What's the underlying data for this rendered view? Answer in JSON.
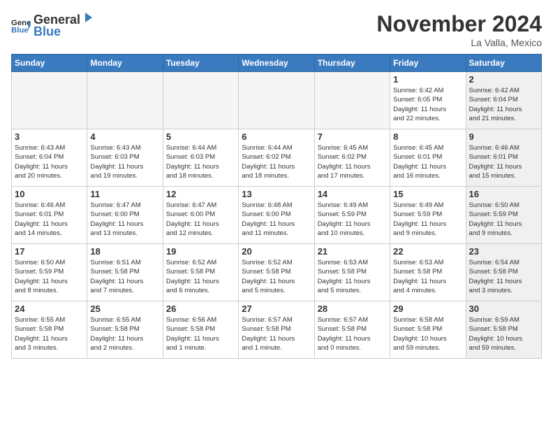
{
  "header": {
    "logo_general": "General",
    "logo_blue": "Blue",
    "month_title": "November 2024",
    "location": "La Valla, Mexico"
  },
  "weekdays": [
    "Sunday",
    "Monday",
    "Tuesday",
    "Wednesday",
    "Thursday",
    "Friday",
    "Saturday"
  ],
  "weeks": [
    [
      {
        "day": "",
        "info": "",
        "empty": true
      },
      {
        "day": "",
        "info": "",
        "empty": true
      },
      {
        "day": "",
        "info": "",
        "empty": true
      },
      {
        "day": "",
        "info": "",
        "empty": true
      },
      {
        "day": "",
        "info": "",
        "empty": true
      },
      {
        "day": "1",
        "info": "Sunrise: 6:42 AM\nSunset: 6:05 PM\nDaylight: 11 hours\nand 22 minutes.",
        "shaded": false
      },
      {
        "day": "2",
        "info": "Sunrise: 6:42 AM\nSunset: 6:04 PM\nDaylight: 11 hours\nand 21 minutes.",
        "shaded": true
      }
    ],
    [
      {
        "day": "3",
        "info": "Sunrise: 6:43 AM\nSunset: 6:04 PM\nDaylight: 11 hours\nand 20 minutes.",
        "shaded": false
      },
      {
        "day": "4",
        "info": "Sunrise: 6:43 AM\nSunset: 6:03 PM\nDaylight: 11 hours\nand 19 minutes.",
        "shaded": false
      },
      {
        "day": "5",
        "info": "Sunrise: 6:44 AM\nSunset: 6:03 PM\nDaylight: 11 hours\nand 18 minutes.",
        "shaded": false
      },
      {
        "day": "6",
        "info": "Sunrise: 6:44 AM\nSunset: 6:02 PM\nDaylight: 11 hours\nand 18 minutes.",
        "shaded": false
      },
      {
        "day": "7",
        "info": "Sunrise: 6:45 AM\nSunset: 6:02 PM\nDaylight: 11 hours\nand 17 minutes.",
        "shaded": false
      },
      {
        "day": "8",
        "info": "Sunrise: 6:45 AM\nSunset: 6:01 PM\nDaylight: 11 hours\nand 16 minutes.",
        "shaded": false
      },
      {
        "day": "9",
        "info": "Sunrise: 6:46 AM\nSunset: 6:01 PM\nDaylight: 11 hours\nand 15 minutes.",
        "shaded": true
      }
    ],
    [
      {
        "day": "10",
        "info": "Sunrise: 6:46 AM\nSunset: 6:01 PM\nDaylight: 11 hours\nand 14 minutes.",
        "shaded": false
      },
      {
        "day": "11",
        "info": "Sunrise: 6:47 AM\nSunset: 6:00 PM\nDaylight: 11 hours\nand 13 minutes.",
        "shaded": false
      },
      {
        "day": "12",
        "info": "Sunrise: 6:47 AM\nSunset: 6:00 PM\nDaylight: 11 hours\nand 12 minutes.",
        "shaded": false
      },
      {
        "day": "13",
        "info": "Sunrise: 6:48 AM\nSunset: 6:00 PM\nDaylight: 11 hours\nand 11 minutes.",
        "shaded": false
      },
      {
        "day": "14",
        "info": "Sunrise: 6:49 AM\nSunset: 5:59 PM\nDaylight: 11 hours\nand 10 minutes.",
        "shaded": false
      },
      {
        "day": "15",
        "info": "Sunrise: 6:49 AM\nSunset: 5:59 PM\nDaylight: 11 hours\nand 9 minutes.",
        "shaded": false
      },
      {
        "day": "16",
        "info": "Sunrise: 6:50 AM\nSunset: 5:59 PM\nDaylight: 11 hours\nand 9 minutes.",
        "shaded": true
      }
    ],
    [
      {
        "day": "17",
        "info": "Sunrise: 6:50 AM\nSunset: 5:59 PM\nDaylight: 11 hours\nand 8 minutes.",
        "shaded": false
      },
      {
        "day": "18",
        "info": "Sunrise: 6:51 AM\nSunset: 5:58 PM\nDaylight: 11 hours\nand 7 minutes.",
        "shaded": false
      },
      {
        "day": "19",
        "info": "Sunrise: 6:52 AM\nSunset: 5:58 PM\nDaylight: 11 hours\nand 6 minutes.",
        "shaded": false
      },
      {
        "day": "20",
        "info": "Sunrise: 6:52 AM\nSunset: 5:58 PM\nDaylight: 11 hours\nand 5 minutes.",
        "shaded": false
      },
      {
        "day": "21",
        "info": "Sunrise: 6:53 AM\nSunset: 5:58 PM\nDaylight: 11 hours\nand 5 minutes.",
        "shaded": false
      },
      {
        "day": "22",
        "info": "Sunrise: 6:53 AM\nSunset: 5:58 PM\nDaylight: 11 hours\nand 4 minutes.",
        "shaded": false
      },
      {
        "day": "23",
        "info": "Sunrise: 6:54 AM\nSunset: 5:58 PM\nDaylight: 11 hours\nand 3 minutes.",
        "shaded": true
      }
    ],
    [
      {
        "day": "24",
        "info": "Sunrise: 6:55 AM\nSunset: 5:58 PM\nDaylight: 11 hours\nand 3 minutes.",
        "shaded": false
      },
      {
        "day": "25",
        "info": "Sunrise: 6:55 AM\nSunset: 5:58 PM\nDaylight: 11 hours\nand 2 minutes.",
        "shaded": false
      },
      {
        "day": "26",
        "info": "Sunrise: 6:56 AM\nSunset: 5:58 PM\nDaylight: 11 hours\nand 1 minute.",
        "shaded": false
      },
      {
        "day": "27",
        "info": "Sunrise: 6:57 AM\nSunset: 5:58 PM\nDaylight: 11 hours\nand 1 minute.",
        "shaded": false
      },
      {
        "day": "28",
        "info": "Sunrise: 6:57 AM\nSunset: 5:58 PM\nDaylight: 11 hours\nand 0 minutes.",
        "shaded": false
      },
      {
        "day": "29",
        "info": "Sunrise: 6:58 AM\nSunset: 5:58 PM\nDaylight: 10 hours\nand 59 minutes.",
        "shaded": false
      },
      {
        "day": "30",
        "info": "Sunrise: 6:59 AM\nSunset: 5:58 PM\nDaylight: 10 hours\nand 59 minutes.",
        "shaded": true
      }
    ]
  ]
}
